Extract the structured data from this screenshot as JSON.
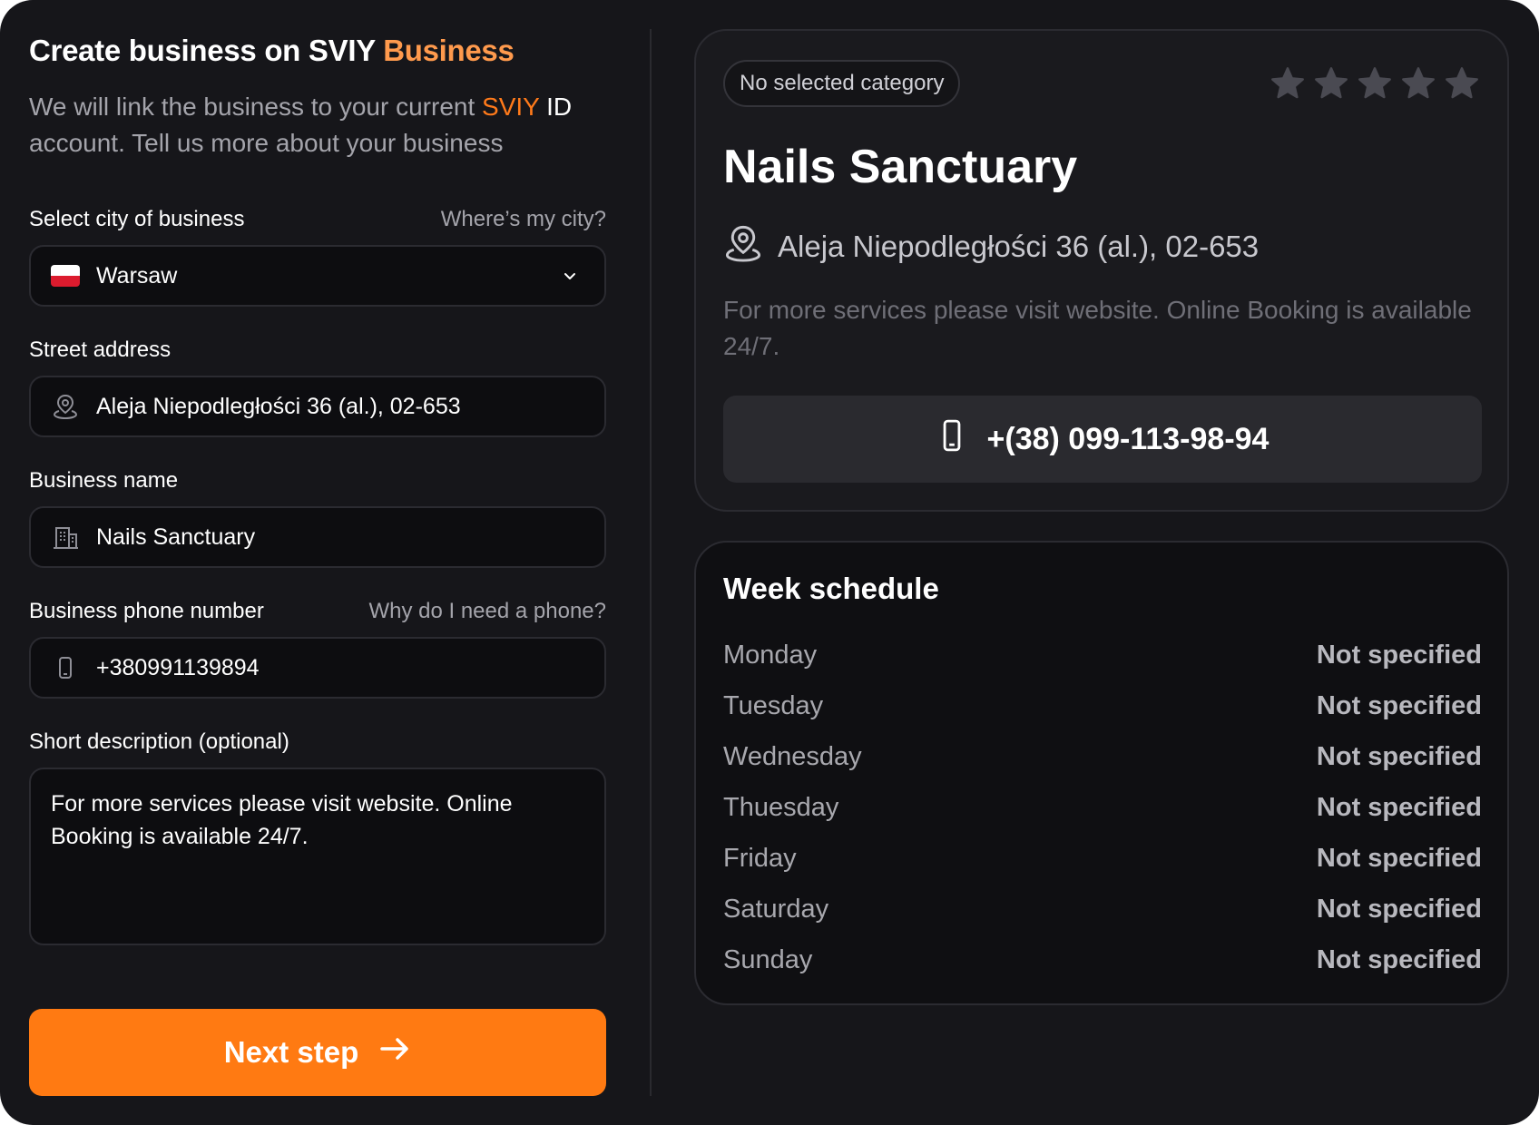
{
  "header": {
    "title_prefix": "Create business on ",
    "brand_name": "SVIY",
    "brand_suffix": "Business",
    "subtitle_before": "We will link the business to your current ",
    "subtitle_brand": "SVIY",
    "subtitle_id": "ID",
    "subtitle_after": " account. Tell us more about your business"
  },
  "form": {
    "city": {
      "label": "Select city of business",
      "hint": "Where’s my city?",
      "value": "Warsaw",
      "flag": "poland-flag"
    },
    "street": {
      "label": "Street address",
      "value": "Aleja Niepodległości 36 (al.), 02-653",
      "icon": "location-pin-icon"
    },
    "name": {
      "label": "Business name",
      "value": "Nails Sanctuary",
      "icon": "building-icon"
    },
    "phone": {
      "label": "Business phone number",
      "hint": "Why do I need a phone?",
      "value": "+380991139894",
      "icon": "smartphone-icon"
    },
    "description": {
      "label": "Short  description (optional)",
      "value": "For more services please visit website. Online Booking is available 24/7."
    },
    "next_label": "Next step"
  },
  "preview": {
    "category": "No selected category",
    "rating": 0,
    "rating_max": 5,
    "name": "Nails Sanctuary",
    "address": "Aleja Niepodległości 36 (al.), 02-653",
    "description": "For more services please visit website. Online Booking is available 24/7.",
    "phone": "+(38) 099-113-98-94"
  },
  "schedule": {
    "title": "Week schedule",
    "days": [
      {
        "day": "Monday",
        "status": "Not specified"
      },
      {
        "day": "Tuesday",
        "status": "Not specified"
      },
      {
        "day": "Wednesday",
        "status": "Not specified"
      },
      {
        "day": "Thuesday",
        "status": "Not specified"
      },
      {
        "day": "Friday",
        "status": "Not specified"
      },
      {
        "day": "Saturday",
        "status": "Not specified"
      },
      {
        "day": "Sunday",
        "status": "Not specified"
      }
    ]
  },
  "colors": {
    "accent": "#ff7a12",
    "brand_orange": "#ff9a4d",
    "background": "#16161a"
  }
}
